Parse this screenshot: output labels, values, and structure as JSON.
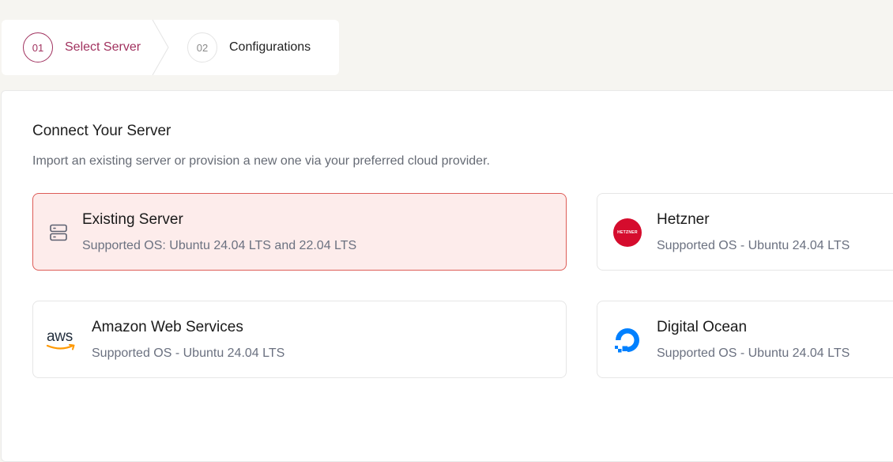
{
  "stepper": {
    "steps": [
      {
        "number": "01",
        "label": "Select Server",
        "active": true
      },
      {
        "number": "02",
        "label": "Configurations",
        "active": false
      }
    ]
  },
  "panel": {
    "title": "Connect Your Server",
    "subtitle": "Import an existing server or provision a new one via your preferred cloud provider."
  },
  "options": {
    "existing": {
      "title": "Existing Server",
      "subtitle": "Supported OS: Ubuntu 24.04 LTS and 22.04 LTS",
      "icon": "server-icon",
      "selected": true
    },
    "hetzner": {
      "title": "Hetzner",
      "subtitle": "Supported OS - Ubuntu 24.04 LTS",
      "icon": "hetzner-logo",
      "logo_text": "HETZNER"
    },
    "aws": {
      "title": "Amazon Web Services",
      "subtitle": "Supported OS - Ubuntu 24.04 LTS",
      "icon": "aws-logo",
      "logo_text": "aws"
    },
    "digitalocean": {
      "title": "Digital Ocean",
      "subtitle": "Supported OS - Ubuntu 24.04 LTS",
      "icon": "digitalocean-logo"
    }
  },
  "colors": {
    "accent": "#a1325f",
    "selected_bg": "#fdeceb",
    "selected_border": "#dd5c57",
    "hetzner_red": "#d50c2d",
    "aws_orange": "#ff9900",
    "digitalocean_blue": "#0080ff"
  }
}
